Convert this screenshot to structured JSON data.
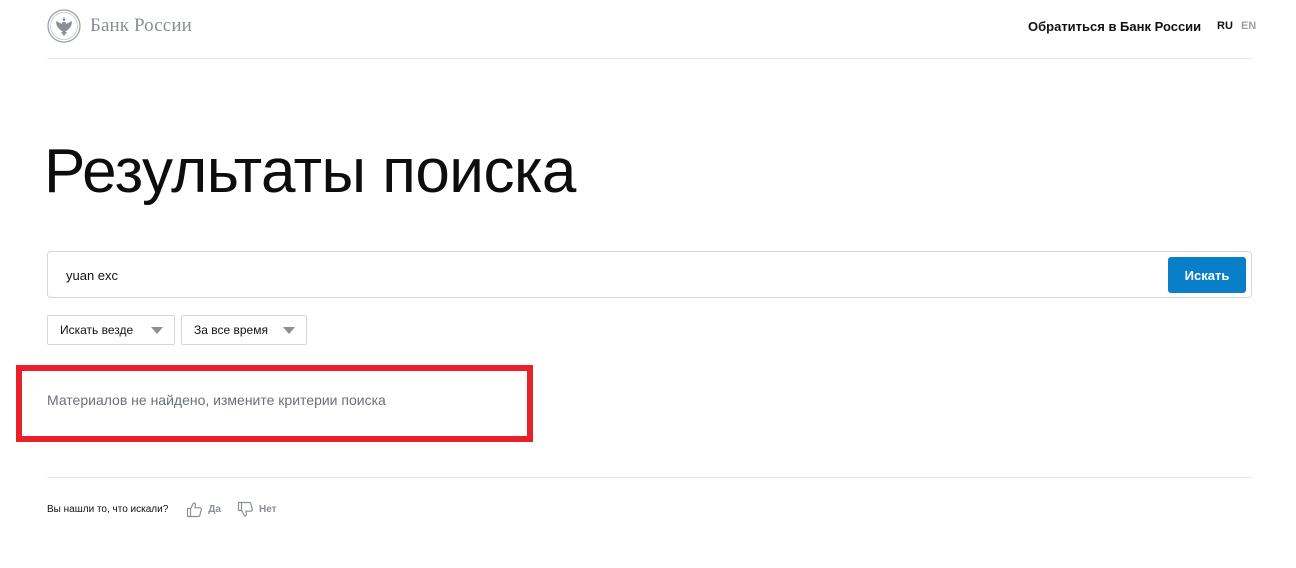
{
  "header": {
    "logo_text": "Банк России",
    "contact_link": "Обратиться в Банк России",
    "lang_ru": "RU",
    "lang_en": "EN"
  },
  "main": {
    "title": "Результаты поиска",
    "search": {
      "value": "yuan exc",
      "button_label": "Искать"
    },
    "filters": [
      {
        "label": "Искать везде"
      },
      {
        "label": "За все время"
      }
    ],
    "no_results_text": "Материалов не найдено, измените критерии поиска"
  },
  "feedback": {
    "question": "Вы нашли то, что искали?",
    "yes_label": "Да",
    "no_label": "Нет"
  },
  "colors": {
    "accent": "#0a7fc9",
    "highlight": "#e8202a",
    "muted_text": "#6b7079"
  },
  "icons": {
    "logo": "eagle-emblem-icon",
    "caret": "chevron-down-icon",
    "yes": "thumbs-up-icon",
    "no": "thumbs-down-icon"
  }
}
